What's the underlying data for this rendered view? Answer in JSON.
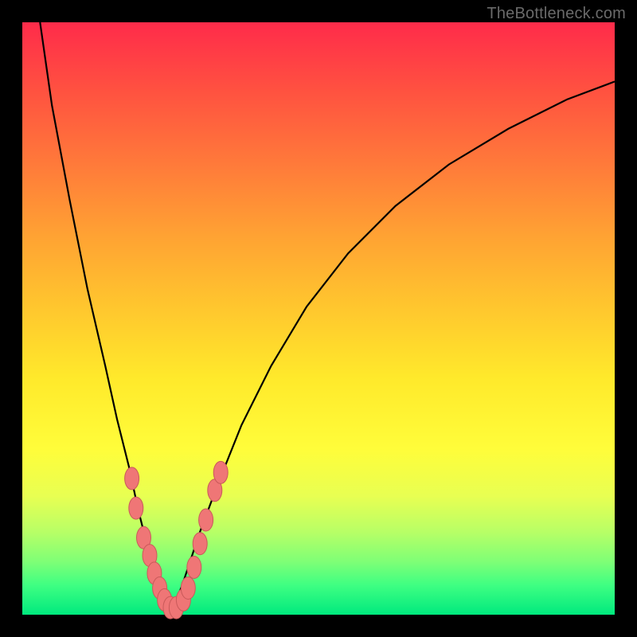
{
  "watermark": "TheBottleneck.com",
  "colors": {
    "background": "#000000",
    "curve": "#000000",
    "bead_fill": "#ef7676",
    "bead_stroke": "#c95a5a",
    "gradient_top": "#ff2b4a",
    "gradient_bottom": "#00e97e"
  },
  "chart_data": {
    "type": "line",
    "title": "",
    "xlabel": "",
    "ylabel": "",
    "xlim": [
      0,
      100
    ],
    "ylim": [
      0,
      100
    ],
    "series": [
      {
        "name": "bottleneck-curve",
        "x": [
          3,
          5,
          8,
          11,
          14,
          16,
          18,
          19.5,
          21,
          22,
          23,
          24,
          25,
          26,
          27,
          28,
          30,
          33,
          37,
          42,
          48,
          55,
          63,
          72,
          82,
          92,
          100
        ],
        "y": [
          100,
          86,
          70,
          55,
          42,
          33,
          25,
          18,
          12,
          8,
          5,
          2.5,
          1,
          2.5,
          5,
          8,
          14,
          22,
          32,
          42,
          52,
          61,
          69,
          76,
          82,
          87,
          90
        ]
      }
    ],
    "beads": {
      "name": "highlighted-points",
      "points": [
        {
          "x": 18.5,
          "y": 23
        },
        {
          "x": 19.2,
          "y": 18
        },
        {
          "x": 20.5,
          "y": 13
        },
        {
          "x": 21.5,
          "y": 10
        },
        {
          "x": 22.3,
          "y": 7
        },
        {
          "x": 23.2,
          "y": 4.5
        },
        {
          "x": 24.0,
          "y": 2.5
        },
        {
          "x": 25.0,
          "y": 1.2
        },
        {
          "x": 26.0,
          "y": 1.2
        },
        {
          "x": 27.2,
          "y": 2.5
        },
        {
          "x": 28.0,
          "y": 4.5
        },
        {
          "x": 29.0,
          "y": 8
        },
        {
          "x": 30.0,
          "y": 12
        },
        {
          "x": 31.0,
          "y": 16
        },
        {
          "x": 32.5,
          "y": 21
        },
        {
          "x": 33.5,
          "y": 24
        }
      ]
    }
  }
}
